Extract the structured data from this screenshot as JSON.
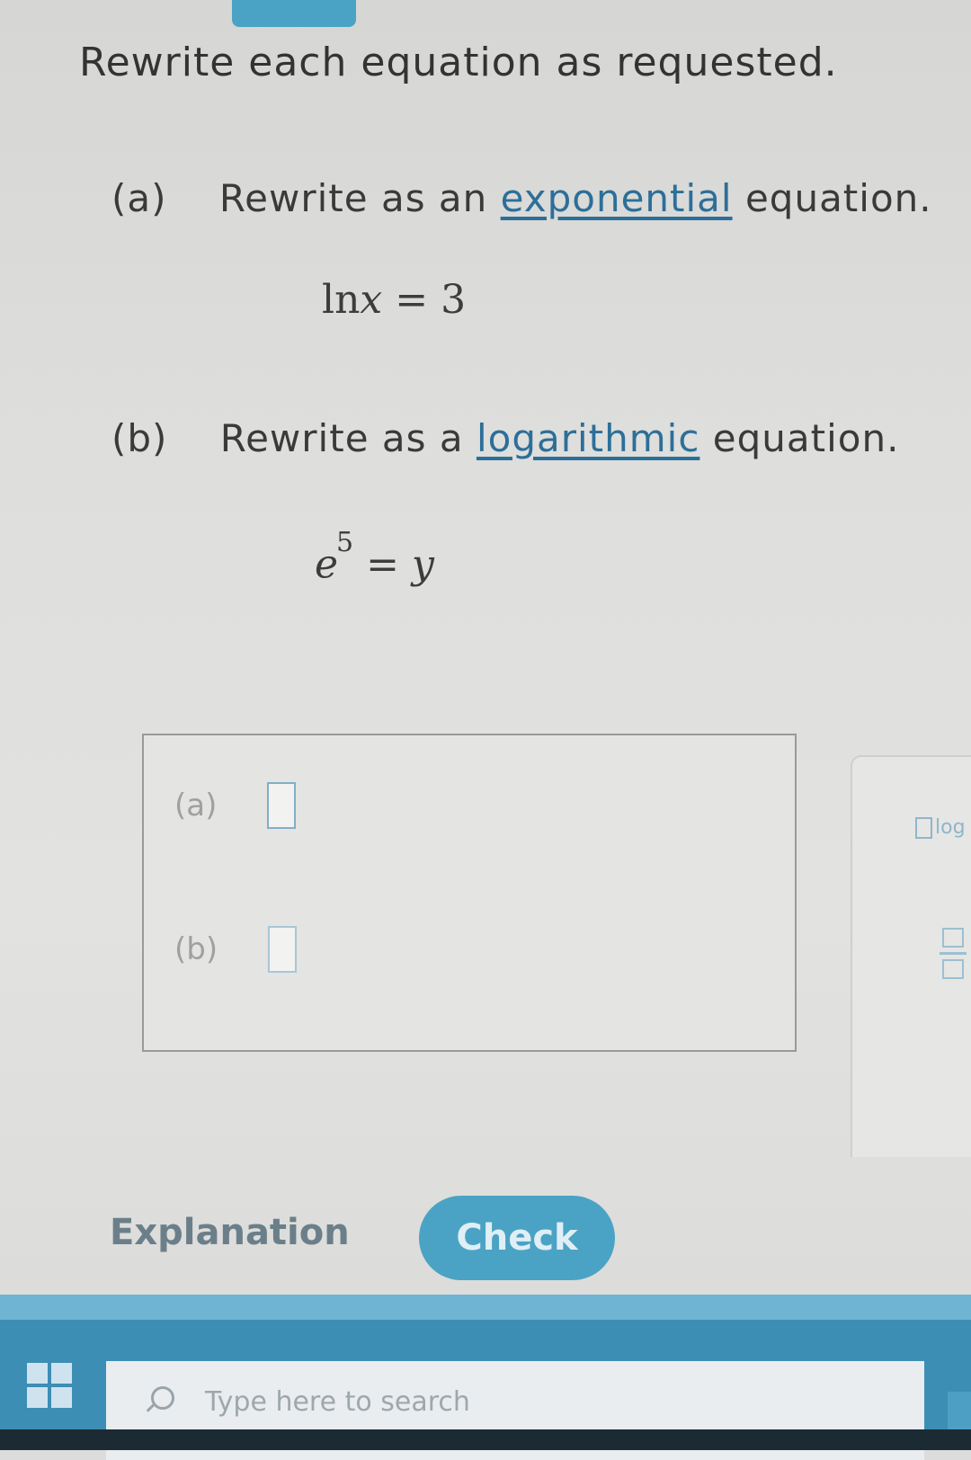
{
  "header": {
    "title": "Rewrite each equation as requested."
  },
  "part_a": {
    "label": "(a)",
    "prompt_before": "Rewrite as an",
    "prompt_link": "exponential",
    "prompt_after": "equation.",
    "equation_fn": "ln",
    "equation_var": "x",
    "equation_rest": "= 3"
  },
  "part_b": {
    "label": "(b)",
    "prompt_before": "Rewrite as a",
    "prompt_link": "logarithmic",
    "prompt_after": "equation.",
    "equation_base": "e",
    "equation_exp": "5",
    "equation_eq": "=",
    "equation_var": "y"
  },
  "answer": {
    "row_a_label": "(a)",
    "row_b_label": "(b)",
    "row_a_value": "",
    "row_b_value": ""
  },
  "toolbar": {
    "log_label": "log",
    "fraction_icon": "fraction-icon"
  },
  "actions": {
    "explanation_label": "Explanation",
    "check_label": "Check"
  },
  "taskbar": {
    "search_placeholder": "Type here to search"
  },
  "colors": {
    "accent": "#4aa3c4",
    "link": "#2c6f99",
    "taskbar": "#3d8eb5"
  }
}
